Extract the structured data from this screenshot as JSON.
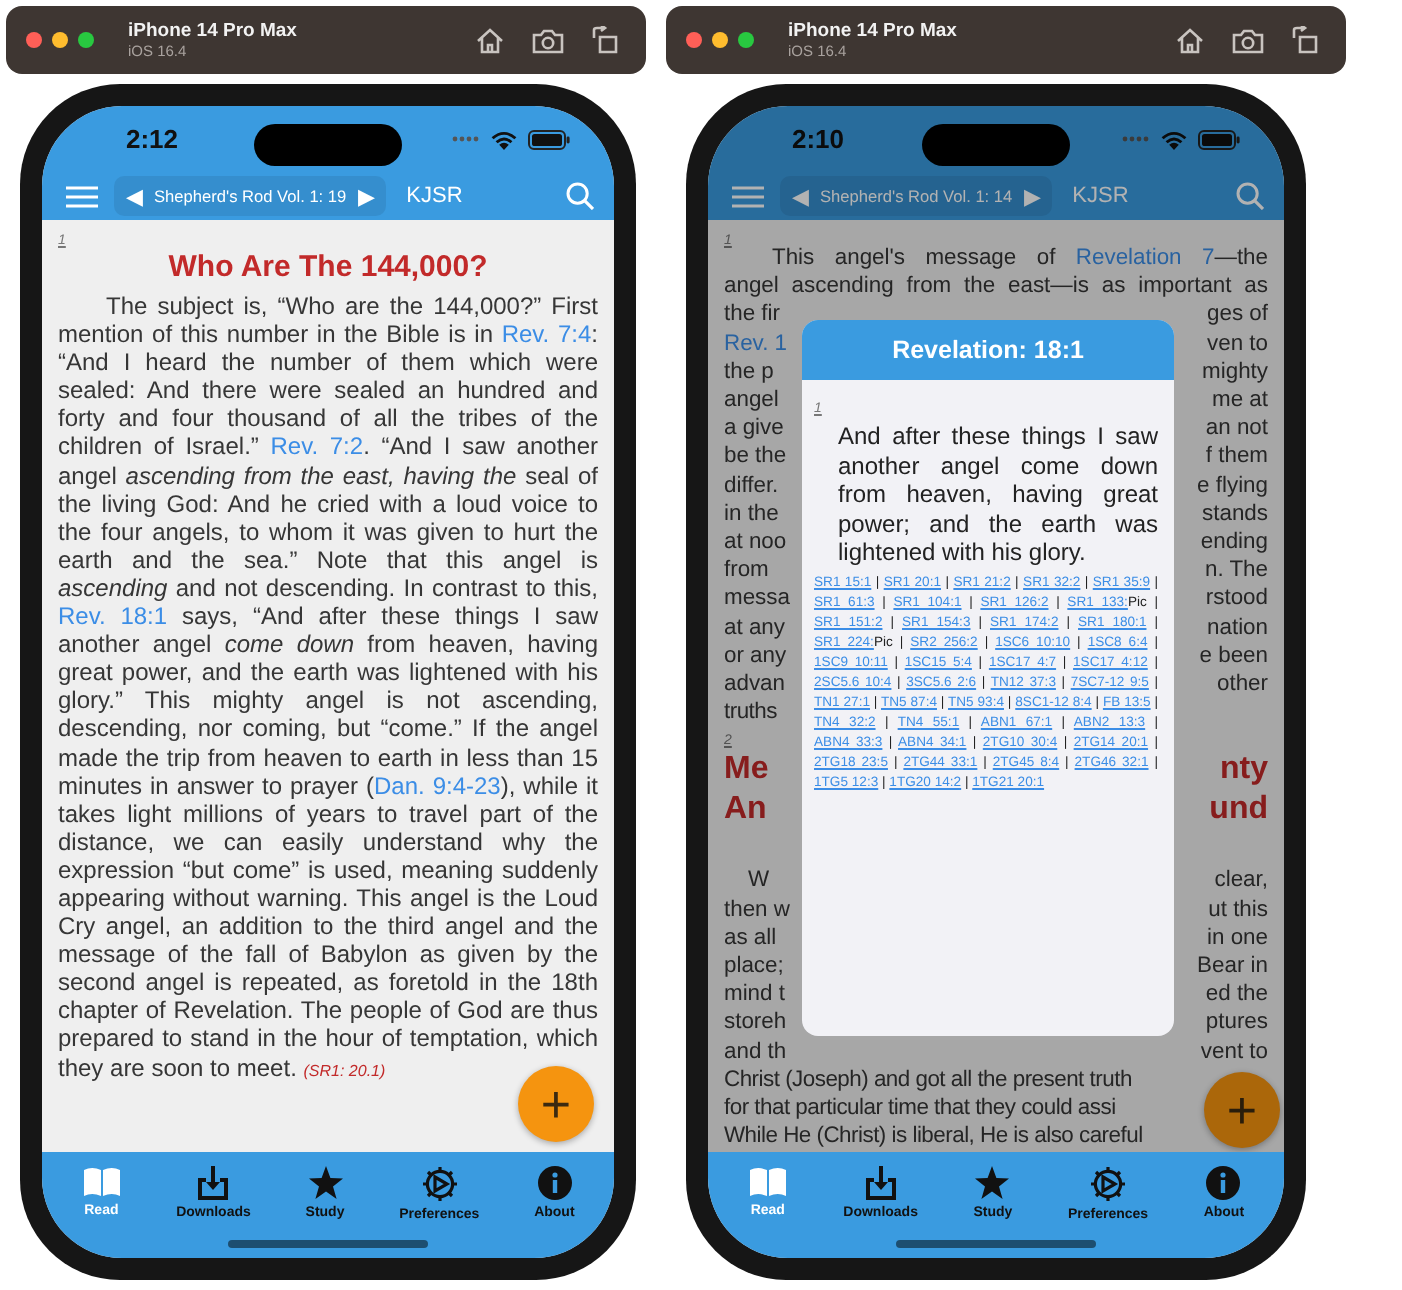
{
  "simulators": [
    {
      "device": "iPhone 14 Pro Max",
      "os": "iOS 16.4",
      "time": "2:12",
      "nav": {
        "prev": "◀",
        "title": "Shepherd's Rod Vol. 1: 19",
        "next": "▶",
        "version": "KJSR"
      },
      "blocks": [
        {
          "kind": "marker",
          "text": "1"
        },
        {
          "kind": "title",
          "text": "Who Are The 144,000?"
        },
        {
          "kind": "prose",
          "segments": [
            {
              "kind": "plain",
              "text": "The subject is, “Who are the 144,000?” First mention of this number in the Bible is in "
            },
            {
              "kind": "link",
              "text": "Rev. 7:4"
            },
            {
              "kind": "plain",
              "text": ": “And I heard the number of them which were sealed: And there were sealed an hundred and forty and four thousand of all the tribes of the children of Israel.” "
            },
            {
              "kind": "link",
              "text": "Rev. 7:2"
            },
            {
              "kind": "plain",
              "text": ". “And I saw another angel "
            },
            {
              "kind": "italic",
              "text": "ascending from the east, having the"
            },
            {
              "kind": "plain",
              "text": " seal of the living God: And he cried with a loud voice to the four angels, to whom it was given to hurt the earth and the sea.” Note that this angel is "
            },
            {
              "kind": "italic",
              "text": "ascending"
            },
            {
              "kind": "plain",
              "text": " and not descending. In contrast to this, "
            },
            {
              "kind": "link",
              "text": "Rev. 18:1"
            },
            {
              "kind": "plain",
              "text": " says, “And after these things I saw another angel "
            },
            {
              "kind": "italic",
              "text": "come down"
            },
            {
              "kind": "plain",
              "text": " from heaven, having great power, and the earth was lightened with his glory.” This mighty angel is not ascending, descending, nor coming, but “come.” If the angel made the trip from heaven to earth in less than 15 minutes in answer to prayer ("
            },
            {
              "kind": "link",
              "text": "Dan. 9:4-23"
            },
            {
              "kind": "plain",
              "text": "), while it takes light millions of years to travel part of the distance, we can easily understand why the expression “but come” is used, meaning suddenly appearing without warning. This angel is the Loud Cry angel, an addition to the third angel and the message of the fall of Babylon as given by the second angel is repeated, as foretold in the 18th chapter of Revelation. The people of God are thus prepared to stand in the hour of temptation, which they are soon to meet. "
            },
            {
              "kind": "citation",
              "text": "(SR1: 20.1)"
            }
          ]
        }
      ],
      "fab": "+",
      "tabs": [
        {
          "label": "Read",
          "selected": true
        },
        {
          "label": "Downloads",
          "selected": false
        },
        {
          "label": "Study",
          "selected": false
        },
        {
          "label": "Preferences",
          "selected": false
        },
        {
          "label": "About",
          "selected": false
        }
      ]
    },
    {
      "device": "iPhone 14 Pro Max",
      "os": "iOS 16.4",
      "time": "2:10",
      "nav": {
        "prev": "◀",
        "title": "Shepherd's Rod Vol. 1: 14",
        "next": "▶",
        "version": "KJSR"
      },
      "blocks": [
        {
          "kind": "marker",
          "text": "1"
        },
        {
          "kind": "paragraph",
          "lines": [
            {
              "left": [
                {
                  "kind": "plain",
                  "text": "This angel's message of "
                },
                {
                  "kind": "link",
                  "text": "Revelation 7"
                },
                {
                  "kind": "plain",
                  "text": "—the"
                }
              ]
            },
            {
              "left": [
                {
                  "kind": "plain",
                  "text": "angel ascending from the east—is as important as"
                }
              ]
            },
            {
              "left": [
                {
                  "kind": "plain",
                  "text": "the fir"
                }
              ],
              "right": [
                {
                  "kind": "plain",
                  "text": "ges of"
                }
              ]
            },
            {
              "left": [
                {
                  "kind": "link",
                  "text": "Rev. 1"
                }
              ],
              "right": [
                {
                  "kind": "plain",
                  "text": "ven to"
                }
              ]
            },
            {
              "left": [
                {
                  "kind": "plain",
                  "text": "the p"
                }
              ],
              "right": [
                {
                  "kind": "plain",
                  "text": "mighty"
                }
              ]
            },
            {
              "left": [
                {
                  "kind": "plain",
                  "text": "angel"
                }
              ],
              "right": [
                {
                  "kind": "plain",
                  "text": "me at"
                }
              ]
            },
            {
              "left": [
                {
                  "kind": "plain",
                  "text": "a give"
                }
              ],
              "right": [
                {
                  "kind": "plain",
                  "text": "an not"
                }
              ]
            },
            {
              "left": [
                {
                  "kind": "plain",
                  "text": "be the"
                }
              ],
              "right": [
                {
                  "kind": "plain",
                  "text": "f them"
                }
              ]
            },
            {
              "left": [
                {
                  "kind": "plain",
                  "text": "differ."
                }
              ],
              "right": [
                {
                  "kind": "plain",
                  "text": "e flying"
                }
              ]
            },
            {
              "left": [
                {
                  "kind": "plain",
                  "text": "in the"
                }
              ],
              "right": [
                {
                  "kind": "plain",
                  "text": "stands"
                }
              ]
            },
            {
              "left": [
                {
                  "kind": "plain",
                  "text": "at noo"
                }
              ],
              "right": [
                {
                  "kind": "plain",
                  "text": "ending"
                }
              ]
            },
            {
              "left": [
                {
                  "kind": "plain",
                  "text": "from"
                }
              ],
              "right": [
                {
                  "kind": "plain",
                  "text": "n. The"
                }
              ]
            },
            {
              "left": [
                {
                  "kind": "plain",
                  "text": "messa"
                }
              ],
              "right": [
                {
                  "kind": "plain",
                  "text": "rstood"
                }
              ]
            },
            {
              "left": [
                {
                  "kind": "plain",
                  "text": "at any"
                }
              ],
              "right": [
                {
                  "kind": "plain",
                  "text": "nation"
                }
              ]
            },
            {
              "left": [
                {
                  "kind": "plain",
                  "text": "or any"
                }
              ],
              "right": [
                {
                  "kind": "plain",
                  "text": "e been"
                }
              ]
            },
            {
              "left": [
                {
                  "kind": "plain",
                  "text": "advan"
                }
              ],
              "right": [
                {
                  "kind": "plain",
                  "text": "other"
                }
              ]
            },
            {
              "left": [
                {
                  "kind": "plain",
                  "text": "truths"
                }
              ]
            }
          ]
        },
        {
          "kind": "marker",
          "text": "2"
        },
        {
          "kind": "heading",
          "lines": [
            {
              "left": "Me",
              "right": "nty"
            },
            {
              "left": "An",
              "right": "und"
            }
          ]
        },
        {
          "kind": "paragraph",
          "lines": [
            {
              "left": [
                {
                  "kind": "plain",
                  "text": "W"
                }
              ],
              "right": [
                {
                  "kind": "plain",
                  "text": "clear,"
                }
              ]
            },
            {
              "left": [
                {
                  "kind": "plain",
                  "text": "then w"
                }
              ],
              "right": [
                {
                  "kind": "plain",
                  "text": "ut this"
                }
              ]
            },
            {
              "left": [
                {
                  "kind": "plain",
                  "text": "as all"
                }
              ],
              "right": [
                {
                  "kind": "plain",
                  "text": "in one"
                }
              ]
            },
            {
              "left": [
                {
                  "kind": "plain",
                  "text": "place;"
                }
              ],
              "right": [
                {
                  "kind": "plain",
                  "text": "Bear in"
                }
              ]
            },
            {
              "left": [
                {
                  "kind": "plain",
                  "text": "mind t"
                }
              ],
              "right": [
                {
                  "kind": "plain",
                  "text": "ed the"
                }
              ]
            },
            {
              "left": [
                {
                  "kind": "plain",
                  "text": "storeh"
                }
              ],
              "right": [
                {
                  "kind": "plain",
                  "text": "ptures"
                }
              ]
            },
            {
              "left": [
                {
                  "kind": "plain",
                  "text": "and th"
                }
              ],
              "right": [
                {
                  "kind": "plain",
                  "text": "vent to"
                }
              ]
            },
            {
              "left": [
                {
                  "kind": "plain",
                  "text": "Christ (Joseph) and got all the present truth"
                }
              ]
            },
            {
              "left": [
                {
                  "kind": "plain",
                  "text": "for that particular time that they could assi"
                }
              ]
            },
            {
              "left": [
                {
                  "kind": "plain",
                  "text": "While He (Christ) is liberal, He is also careful"
                }
              ]
            }
          ]
        }
      ],
      "popup": {
        "title": "Revelation: 18:1",
        "marker": "1",
        "verse": "And after these things I saw another angel come down from heaven, having great power; and the earth was lightened with his glory.",
        "separator": "|",
        "references": [
          {
            "link": "SR1 15:1"
          },
          {
            "link": "SR1 20:1"
          },
          {
            "link": "SR1 21:2"
          },
          {
            "link": "SR1 32:2"
          },
          {
            "link": "SR1 35:9"
          },
          {
            "link": "SR1 61:3"
          },
          {
            "link": "SR1 104:1"
          },
          {
            "link": "SR1 126:2"
          },
          {
            "link": "SR1 133:",
            "suffix": "Pic"
          },
          {
            "link": "SR1 151:2"
          },
          {
            "link": "SR1 154:3"
          },
          {
            "link": "SR1 174:2"
          },
          {
            "link": "SR1 180:1"
          },
          {
            "link": "SR1 224:",
            "suffix": "Pic"
          },
          {
            "link": "SR2 256:2"
          },
          {
            "link": "1SC6 10:10"
          },
          {
            "link": "1SC8 6:4"
          },
          {
            "link": "1SC9 10:11"
          },
          {
            "link": "1SC15 5:4"
          },
          {
            "link": "1SC17 4:7"
          },
          {
            "link": "1SC17 4:12"
          },
          {
            "link": "2SC5.6 10:4"
          },
          {
            "link": "3SC5.6 2:6"
          },
          {
            "link": "TN12 37:3"
          },
          {
            "link": "7SC7-12 9:5"
          },
          {
            "link": "TN1 27:1"
          },
          {
            "link": "TN5 87:4"
          },
          {
            "link": "TN5 93:4"
          },
          {
            "link": "8SC1-12 8:4"
          },
          {
            "link": "FB 13:5"
          },
          {
            "link": "TN4 32:2"
          },
          {
            "link": "TN4 55:1"
          },
          {
            "link": "ABN1 67:1"
          },
          {
            "link": "ABN2 13:3"
          },
          {
            "link": "ABN4 33:3"
          },
          {
            "link": "ABN4 34:1"
          },
          {
            "link": "2TG10 30:4"
          },
          {
            "link": "2TG14 20:1"
          },
          {
            "link": "2TG18 23:5"
          },
          {
            "link": "2TG44 33:1"
          },
          {
            "link": "2TG45 8:4"
          },
          {
            "link": "2TG46 32:1"
          },
          {
            "link": "1TG5 12:3"
          },
          {
            "link": "1TG20 14:2"
          },
          {
            "link": "1TG21 20:1"
          }
        ]
      },
      "fab": "+",
      "tabs": [
        {
          "label": "Read",
          "selected": true
        },
        {
          "label": "Downloads",
          "selected": false
        },
        {
          "label": "Study",
          "selected": false
        },
        {
          "label": "Preferences",
          "selected": false
        },
        {
          "label": "About",
          "selected": false
        }
      ]
    }
  ]
}
